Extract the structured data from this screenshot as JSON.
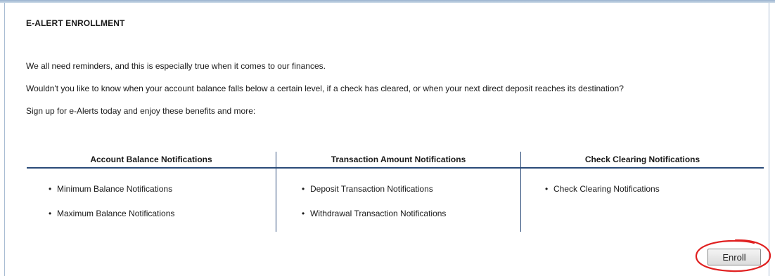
{
  "page": {
    "title": "E-ALERT ENROLLMENT",
    "paragraphs": [
      "We all need reminders, and this is especially true when it comes to our finances.",
      "Wouldn't you like to know when your account balance falls below a certain level, if a check has cleared, or when your next direct deposit reaches its destination?",
      "Sign up for e-Alerts today and enjoy these benefits and more:"
    ]
  },
  "columns": [
    {
      "heading": "Account Balance Notifications",
      "items": [
        "Minimum Balance Notifications",
        "Maximum Balance Notifications"
      ]
    },
    {
      "heading": "Transaction Amount Notifications",
      "items": [
        "Deposit Transaction Notifications",
        "Withdrawal Transaction Notifications"
      ]
    },
    {
      "heading": "Check Clearing Notifications",
      "items": [
        "Check Clearing Notifications"
      ]
    }
  ],
  "bullet_char": "•",
  "actions": {
    "enroll_label": "Enroll"
  },
  "colors": {
    "divider": "#2a4a78",
    "annotation_circle": "#e02020",
    "panel_border": "#a9bcd3"
  },
  "icons": {
    "annotation": "red-circle-highlight"
  }
}
